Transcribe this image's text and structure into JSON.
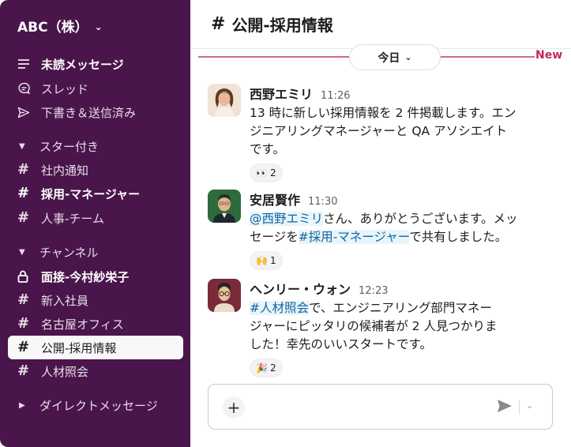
{
  "workspace": {
    "name": "ABC（株）"
  },
  "sidebar": {
    "items": [
      {
        "label": "未読メッセージ",
        "icon": "unread-icon",
        "bold": true
      },
      {
        "label": "スレッド",
        "icon": "threads-icon"
      },
      {
        "label": "下書き＆送信済み",
        "icon": "send-icon"
      }
    ],
    "sections": {
      "starred": "スター付き",
      "channels": "チャンネル",
      "dms": "ダイレクトメッセージ"
    },
    "starred": [
      {
        "label": "社内通知",
        "icon": "hash"
      },
      {
        "label": "採用-マネージャー",
        "icon": "hash",
        "bold": true
      },
      {
        "label": "人事-チーム",
        "icon": "hash"
      }
    ],
    "channels": [
      {
        "label": "面接-今村紗栄子",
        "icon": "lock",
        "bold": true
      },
      {
        "label": "新入社員",
        "icon": "hash"
      },
      {
        "label": "名古屋オフィス",
        "icon": "hash"
      },
      {
        "label": "公開-採用情報",
        "icon": "hash",
        "active": true
      },
      {
        "label": "人材照会",
        "icon": "hash"
      }
    ]
  },
  "header": {
    "channel": "公開-採用情報"
  },
  "timeline": {
    "today_label": "今日",
    "new_label": "New"
  },
  "messages": [
    {
      "name": "西野エミリ",
      "time": "11:26",
      "text_lines": [
        "13 時に新しい採用情報を 2 件掲載します。エン",
        "ジニアリングマネージャーと QA アソシエイト",
        "です。"
      ],
      "reaction": {
        "emoji": "👀",
        "count": "2"
      }
    },
    {
      "name": "安居賢作",
      "time": "11:30",
      "mention": "@西野エミリ",
      "line1_rest": "さん、ありがとうございます。メッ",
      "line2_pre": "セージを",
      "channel_link": "#採用-マネージャー",
      "line2_post": "で共有しました。",
      "reaction": {
        "emoji": "🙌",
        "count": "1"
      }
    },
    {
      "name": "ヘンリー・ウォン",
      "time": "12:23",
      "channel_link": "#人材照会",
      "line1_rest": "で、エンジニアリング部門マネー",
      "text_lines": [
        "ジャーにピッタリの候補者が 2 人見つかりま",
        "した！幸先のいいスタートです。"
      ],
      "reaction": {
        "emoji": "🎉",
        "count": "2"
      }
    }
  ],
  "colors": {
    "sidebar": "#4a154b",
    "accent": "#c1285a",
    "link": "#1264a3"
  }
}
